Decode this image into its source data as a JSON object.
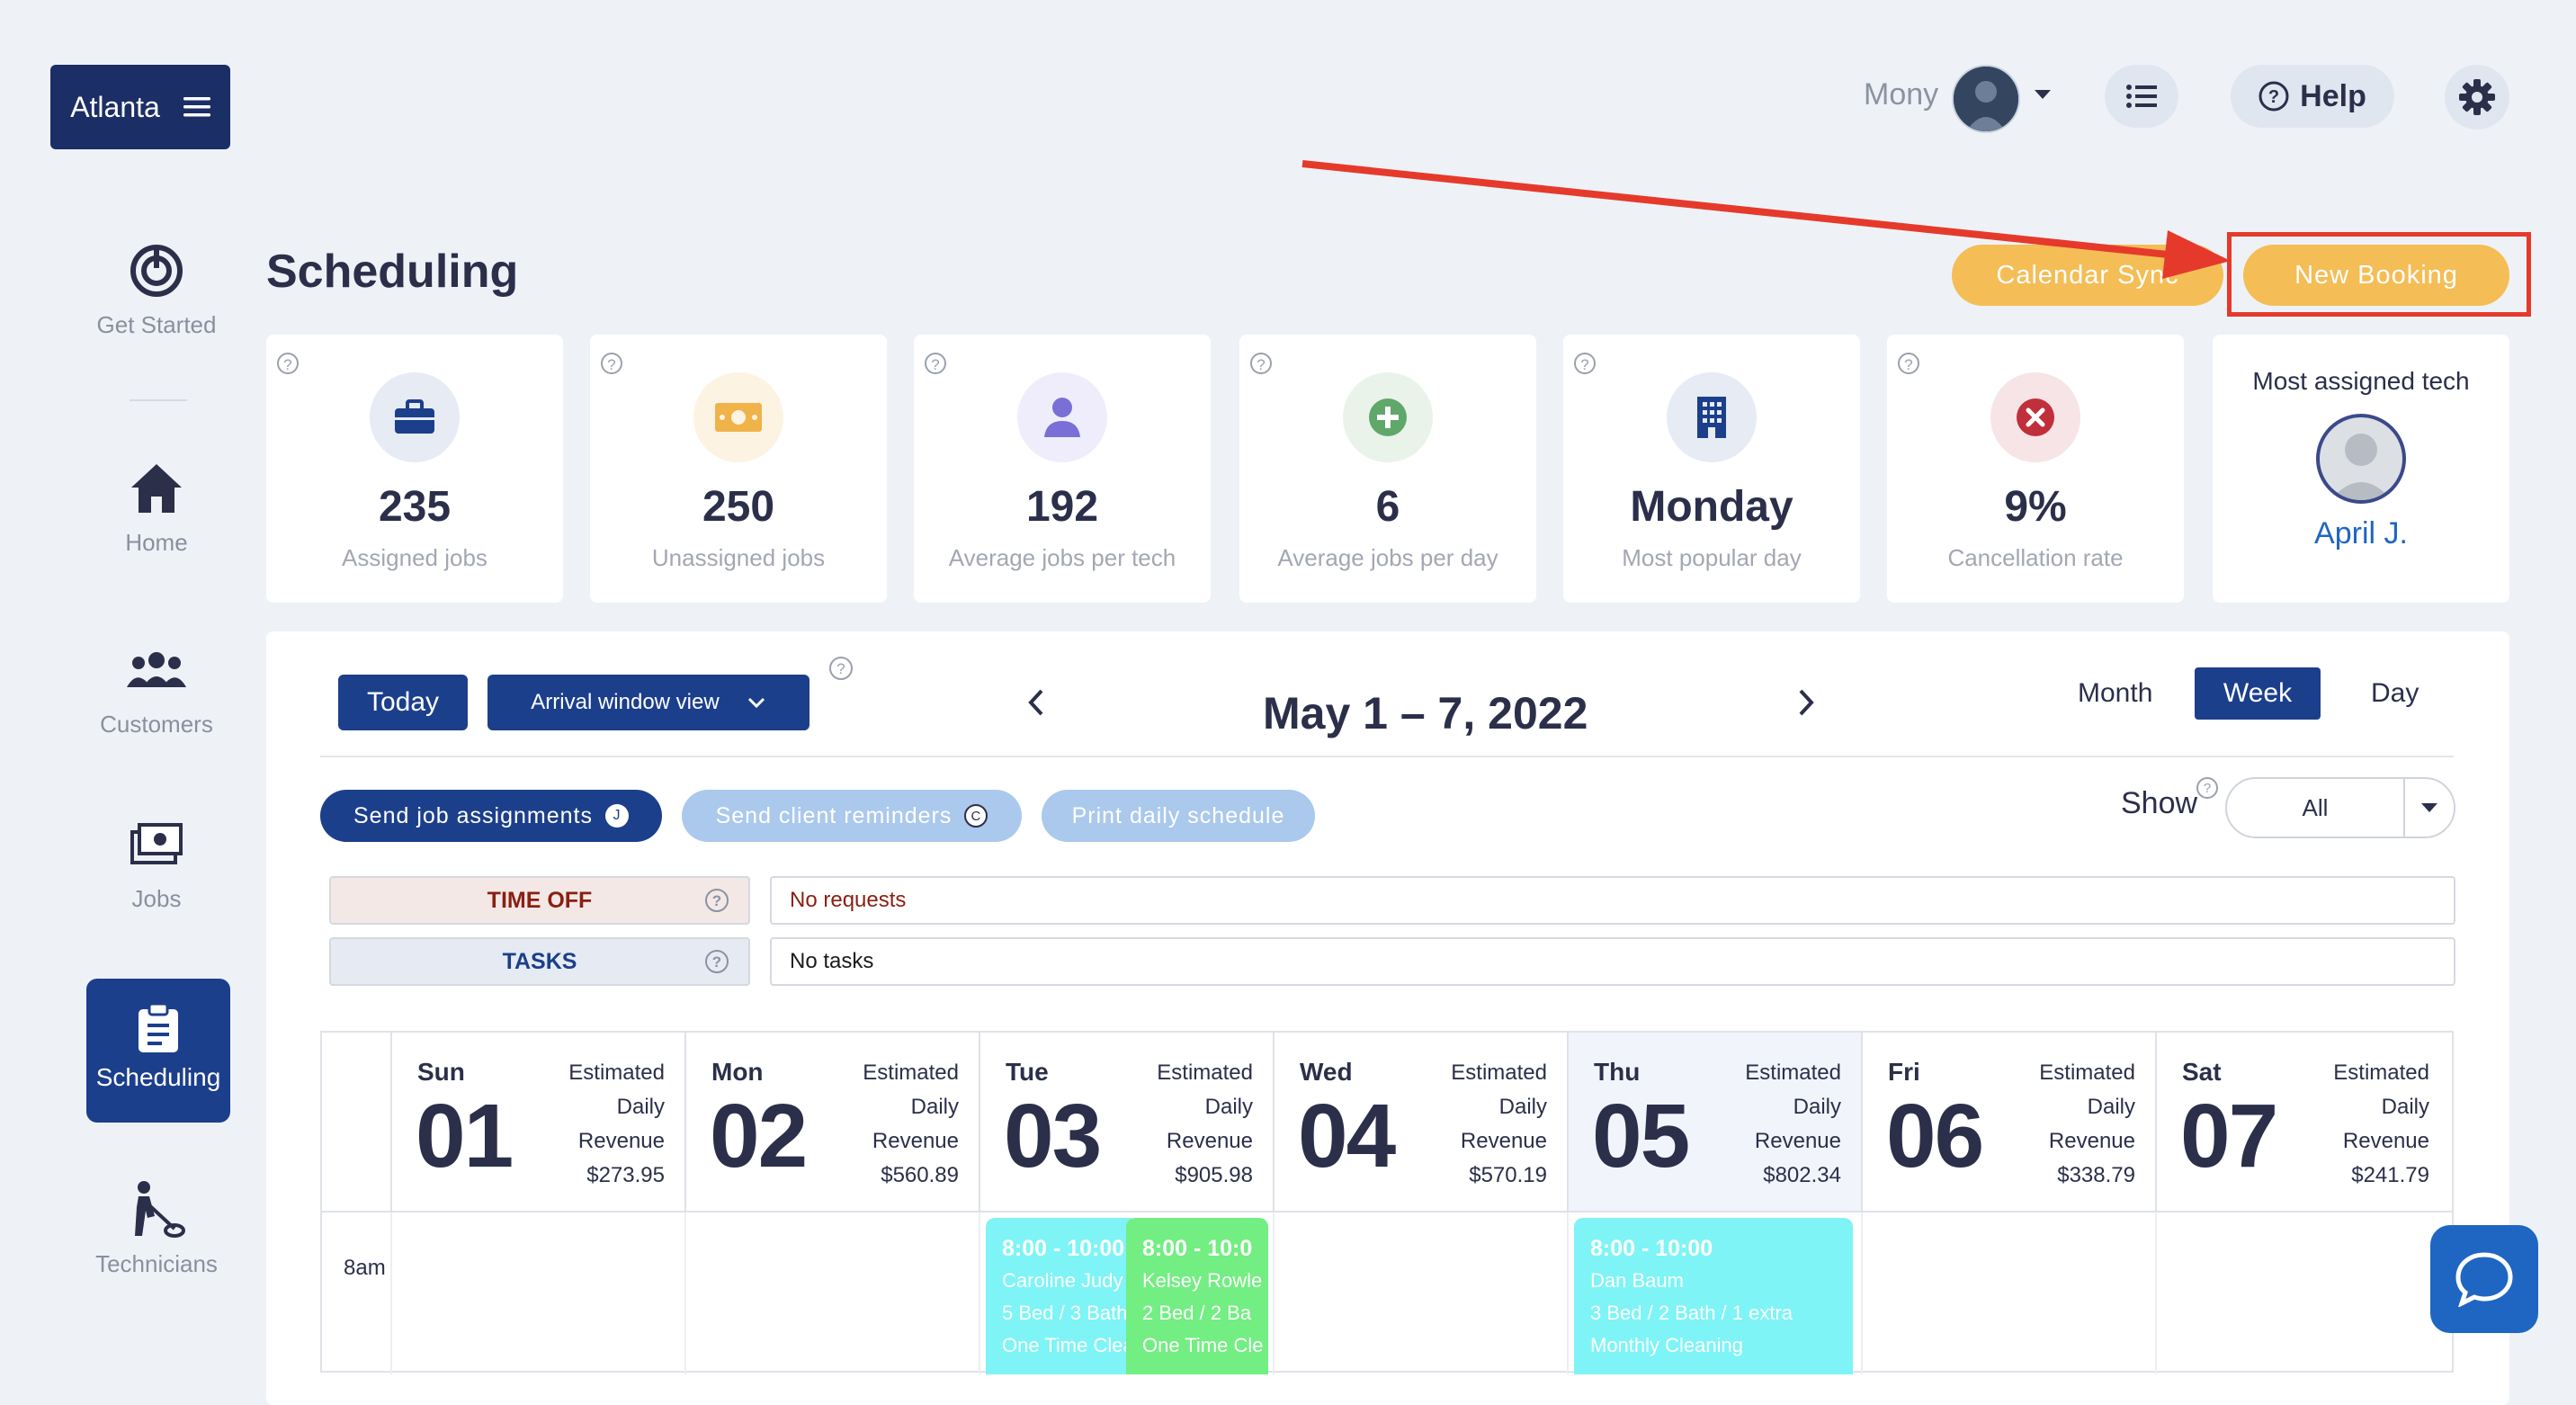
{
  "location": {
    "name": "Atlanta"
  },
  "header": {
    "user_name": "Mony",
    "help_label": "Help"
  },
  "sidebar": {
    "items": [
      {
        "label": "Get Started"
      },
      {
        "label": "Home"
      },
      {
        "label": "Customers"
      },
      {
        "label": "Jobs"
      },
      {
        "label": "Scheduling"
      },
      {
        "label": "Technicians"
      }
    ]
  },
  "page": {
    "title": "Scheduling",
    "calendar_sync_label": "Calendar Sync",
    "new_booking_label": "New Booking"
  },
  "stats": [
    {
      "value": "235",
      "label": "Assigned jobs",
      "icon": "briefcase-icon",
      "color": "#1c3f8c"
    },
    {
      "value": "250",
      "label": "Unassigned jobs",
      "icon": "cash-icon",
      "color": "#f0b34a"
    },
    {
      "value": "192",
      "label": "Average jobs per tech",
      "icon": "person-icon",
      "color": "#7a6fd6"
    },
    {
      "value": "6",
      "label": "Average jobs per day",
      "icon": "plus-circle-icon",
      "color": "#5fa86a"
    },
    {
      "value": "Monday",
      "label": "Most popular day",
      "icon": "building-icon",
      "color": "#1c3f8c"
    },
    {
      "value": "9%",
      "label": "Cancellation rate",
      "icon": "x-circle-icon",
      "color": "#c0303a"
    }
  ],
  "most_assigned": {
    "title": "Most assigned tech",
    "name": "April J."
  },
  "toolbar": {
    "today_label": "Today",
    "arrival_label": "Arrival window view",
    "date_range": "May 1 – 7, 2022",
    "views": {
      "month": "Month",
      "week": "Week",
      "day": "Day"
    }
  },
  "actions": {
    "send_jobs": "Send job assignments",
    "send_jobs_badge": "J",
    "send_reminders": "Send client reminders",
    "send_reminders_badge": "C",
    "print": "Print daily schedule",
    "show_label": "Show",
    "show_value": "All"
  },
  "rows": {
    "time_off_label": "TIME OFF",
    "time_off_value": "No requests",
    "tasks_label": "TASKS",
    "tasks_value": "No tasks"
  },
  "calendar": {
    "est_label_1": "Estimated",
    "est_label_2": "Daily",
    "est_label_3": "Revenue",
    "time_label": "8am",
    "days": [
      {
        "name": "Sun",
        "num": "01",
        "revenue": "$273.95"
      },
      {
        "name": "Mon",
        "num": "02",
        "revenue": "$560.89"
      },
      {
        "name": "Tue",
        "num": "03",
        "revenue": "$905.98"
      },
      {
        "name": "Wed",
        "num": "04",
        "revenue": "$570.19"
      },
      {
        "name": "Thu",
        "num": "05",
        "revenue": "$802.34"
      },
      {
        "name": "Fri",
        "num": "06",
        "revenue": "$338.79"
      },
      {
        "name": "Sat",
        "num": "07",
        "revenue": "$241.79"
      }
    ],
    "jobs": [
      {
        "time": "8:00 - 10:00",
        "client": "Caroline Judy",
        "detail": "5 Bed / 3 Bath",
        "type": "One Time Clea",
        "color": "#7ef4f6"
      },
      {
        "time": "8:00 - 10:0",
        "client": "Kelsey Rowle",
        "detail": "2 Bed / 2 Ba",
        "type": "One Time Cle",
        "color": "#72ee82"
      },
      {
        "time": "8:00 - 10:00",
        "client": "Dan Baum",
        "detail": "3 Bed / 2 Bath / 1 extra",
        "type": "Monthly Cleaning",
        "color": "#7ef4f6"
      }
    ]
  },
  "colors": {
    "primary": "#1c3f8c",
    "accent": "#f5bd55",
    "annotation": "#e53a2b"
  }
}
